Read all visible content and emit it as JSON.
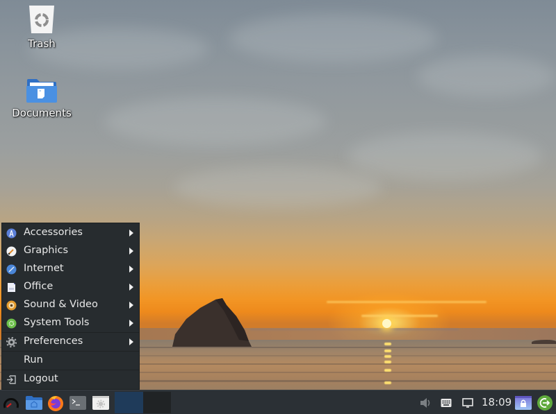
{
  "desktop": {
    "icons": [
      {
        "label": "Trash",
        "icon": "trash-icon"
      },
      {
        "label": "Documents",
        "icon": "folder-documents-icon"
      }
    ]
  },
  "app_menu": {
    "items": [
      {
        "label": "Accessories",
        "icon": "accessories-icon",
        "submenu": true
      },
      {
        "label": "Graphics",
        "icon": "graphics-icon",
        "submenu": true
      },
      {
        "label": "Internet",
        "icon": "internet-icon",
        "submenu": true
      },
      {
        "label": "Office",
        "icon": "office-icon",
        "submenu": true
      },
      {
        "label": "Sound & Video",
        "icon": "sound-video-icon",
        "submenu": true
      },
      {
        "label": "System Tools",
        "icon": "system-tools-icon",
        "submenu": true
      },
      {
        "label": "Preferences",
        "icon": "gear-icon",
        "submenu": true
      },
      {
        "label": "Run",
        "icon": null,
        "submenu": false
      },
      {
        "label": "Logout",
        "icon": "logout-icon",
        "submenu": false
      }
    ]
  },
  "panel": {
    "launchers": [
      {
        "name": "app-menu-button",
        "icon": "speedometer-menu-icon"
      },
      {
        "name": "file-manager-launcher",
        "icon": "home-folder-icon"
      },
      {
        "name": "firefox-launcher",
        "icon": "firefox-icon"
      },
      {
        "name": "terminal-launcher",
        "icon": "terminal-icon"
      },
      {
        "name": "settings-launcher",
        "icon": "settings-window-icon"
      }
    ],
    "workspaces": [
      {
        "name": "workspace-1",
        "active": true
      },
      {
        "name": "workspace-2",
        "active": false
      }
    ],
    "tray": {
      "volume_icon": "volume-icon",
      "keyboard_icon": "keyboard-icon",
      "display_icon": "display-icon",
      "clock": "18:09",
      "lock_icon": "lock-screen-icon",
      "logout_icon": "power-logout-icon"
    }
  },
  "colors": {
    "menu_bg": "#272c2f",
    "panel_bg": "#2b3035",
    "active_workspace": "#1f3b5a",
    "accent_green": "#5faa3c"
  }
}
